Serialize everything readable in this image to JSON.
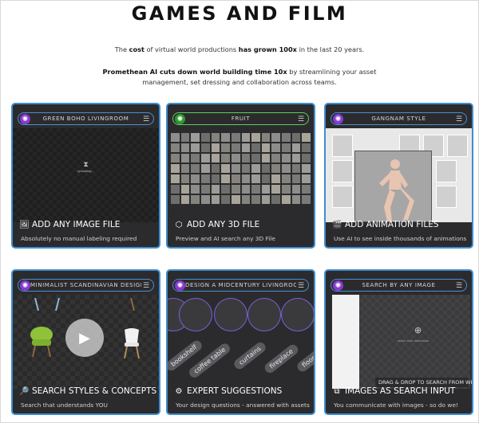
{
  "page": {
    "title": "GAMES AND FILM",
    "intro": {
      "p1_pre": "The ",
      "p1_b1": "cost",
      "p1_mid": " of virtual world productions ",
      "p1_b2": "has grown 100x",
      "p1_post": " in the last 20 years.",
      "p2_b": "Promethean AI cuts down world building time 10x",
      "p2_post": " by streamlining your asset management, set dressing and collaboration across teams."
    }
  },
  "cards": [
    {
      "pill": "GREEN BOHO LIVINGROOM",
      "caption": "ADD ANY IMAGE FILE",
      "sub": "Absolutely no manual labeling required",
      "icon": "image-icon",
      "upload": "Uploading…"
    },
    {
      "pill": "FRUIT",
      "caption": "ADD ANY 3D FILE",
      "sub": "Preview and AI search any 3D File",
      "icon": "cube-icon"
    },
    {
      "pill": "GANGNAM STYLE",
      "caption": "ADD ANIMATION FILES",
      "sub": "Use AI to see inside thousands of animations",
      "icon": "clapper-icon"
    },
    {
      "pill": "MINIMALIST SCANDINAVIAN DESIGN",
      "caption": "SEARCH STYLES & CONCEPTS",
      "sub": "Search that understands YOU",
      "icon": "search-icon"
    },
    {
      "pill": "DESIGN A MIDCENTURY LIVINGROOM",
      "caption": "EXPERT SUGGESTIONS",
      "sub": "Your design questions - answered with assets",
      "icon": "gear-icon",
      "tags": [
        "bookshelf",
        "coffee table",
        "curtains",
        "fireplace",
        "floor l"
      ]
    },
    {
      "pill": "SEARCH BY ANY IMAGE",
      "caption": "IMAGES AS SEARCH INPUT",
      "sub": "You communicate with images - so do we!",
      "icon": "image-input-icon",
      "drag_label": "DRAG & DROP TO SEARCH FROM WEB"
    }
  ],
  "colors": {
    "card_border": "#3e8ed0",
    "card_bg": "#2b2b2d",
    "pill_green": "#5bd05b",
    "logo_purple": "#8a3ad0"
  }
}
